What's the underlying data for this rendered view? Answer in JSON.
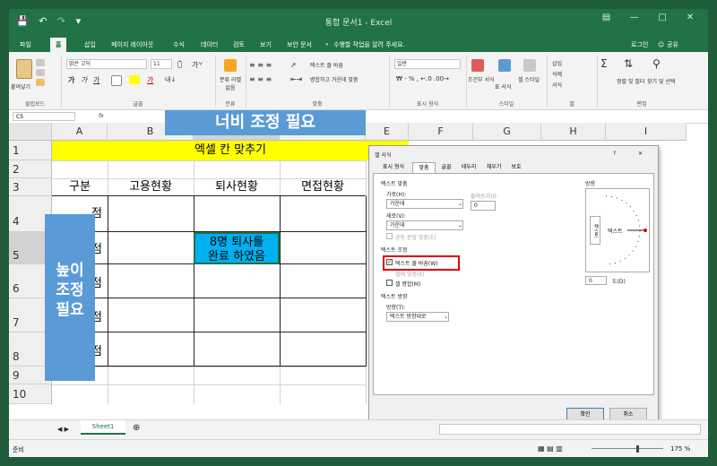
{
  "window": {
    "title": "통합 문서1 - Excel",
    "login": "로그인",
    "share": "공유"
  },
  "ribbon_tabs": [
    "파일",
    "홈",
    "삽입",
    "페이지 레이아웃",
    "수식",
    "데이터",
    "검토",
    "보기",
    "보안 문서"
  ],
  "ribbon_tab_active": "홈",
  "tell_me": "수행할 작업을 알려 주세요.",
  "ribbon": {
    "paste_label": "붙여넣기",
    "clipboard_label": "클립보드",
    "font_name": "맑은 고딕",
    "font_size": "11",
    "font_label": "글꼴",
    "phonetic_label": "분류 라벨 없음",
    "phonetic_group": "분류",
    "wrap_text": "텍스트 줄 바꿈",
    "merge_center": "병합하고 가운데 맞춤",
    "align_label": "맞춤",
    "number_format": "일반",
    "number_label": "표시 형식",
    "cond_format": "조건부 서식",
    "format_table": "표 서식",
    "cell_style": "셀 스타일",
    "style_label": "스타일",
    "insert": "삽입",
    "delete": "삭제",
    "format": "서식",
    "cells_label": "셀",
    "sort_filter": "정렬 및 필터",
    "find_select": "찾기 및 선택",
    "edit_label": "편집"
  },
  "formula_bar": {
    "name_box": "C5",
    "fx": "fx"
  },
  "columns": [
    "A",
    "B",
    "C",
    "D",
    "E",
    "F",
    "G",
    "H",
    "I"
  ],
  "rows": [
    "1",
    "2",
    "3",
    "4",
    "5",
    "6",
    "7",
    "8",
    "9",
    "10"
  ],
  "cells": {
    "title": "엑셀 칸 맞추기",
    "a3": "구분",
    "b3": "고용현황",
    "c3": "퇴사현황",
    "d3": "면접현황",
    "a_partial": [
      "점",
      "점",
      "점",
      "점",
      "점"
    ],
    "c5_line1": "8명 퇴사를",
    "c5_line2": "완료 하였음"
  },
  "callouts": {
    "width": "너비 조정 필요",
    "height_lines": [
      "높이",
      "조정",
      "필요"
    ]
  },
  "dialog": {
    "title": "셀 서식",
    "help": "?",
    "close": "✕",
    "tabs": [
      "표시 형식",
      "맞춤",
      "글꼴",
      "테두리",
      "채우기",
      "보호"
    ],
    "active_tab": "맞춤",
    "text_align_section": "텍스트 맞춤",
    "horizontal_label": "가로(H):",
    "horizontal_value": "가운데",
    "indent_label": "들여쓰기(I):",
    "indent_value": "0",
    "vertical_label": "세로(V):",
    "vertical_value": "가운데",
    "justify_distributed": "균등 분할 맞춤(E)",
    "text_control_section": "텍스트 조정",
    "wrap_text": "텍스트 줄 바꿈(W)",
    "shrink_to_fit": "셀에 맞춤(K)",
    "merge_cells": "셀 병합(M)",
    "direction_section": "텍스트 방향",
    "direction_label": "방향(T):",
    "direction_value": "텍스트 방향대로",
    "orientation_section": "방향",
    "orientation_vertical": "텍스트",
    "orientation_text": "텍스트",
    "degree_value": "0",
    "degree_label": "도(D)",
    "ok": "확인",
    "cancel": "취소",
    "wrap_checked": true
  },
  "sheet_tab": "Sheet1",
  "status": {
    "ready": "준비",
    "zoom": "175 %"
  },
  "colors": {
    "excel_green": "#217346",
    "title_fill": "#ffff00",
    "callout_blue": "#5b9bd5",
    "cell_blue": "#00b0f0",
    "highlight_red": "#e00000"
  }
}
